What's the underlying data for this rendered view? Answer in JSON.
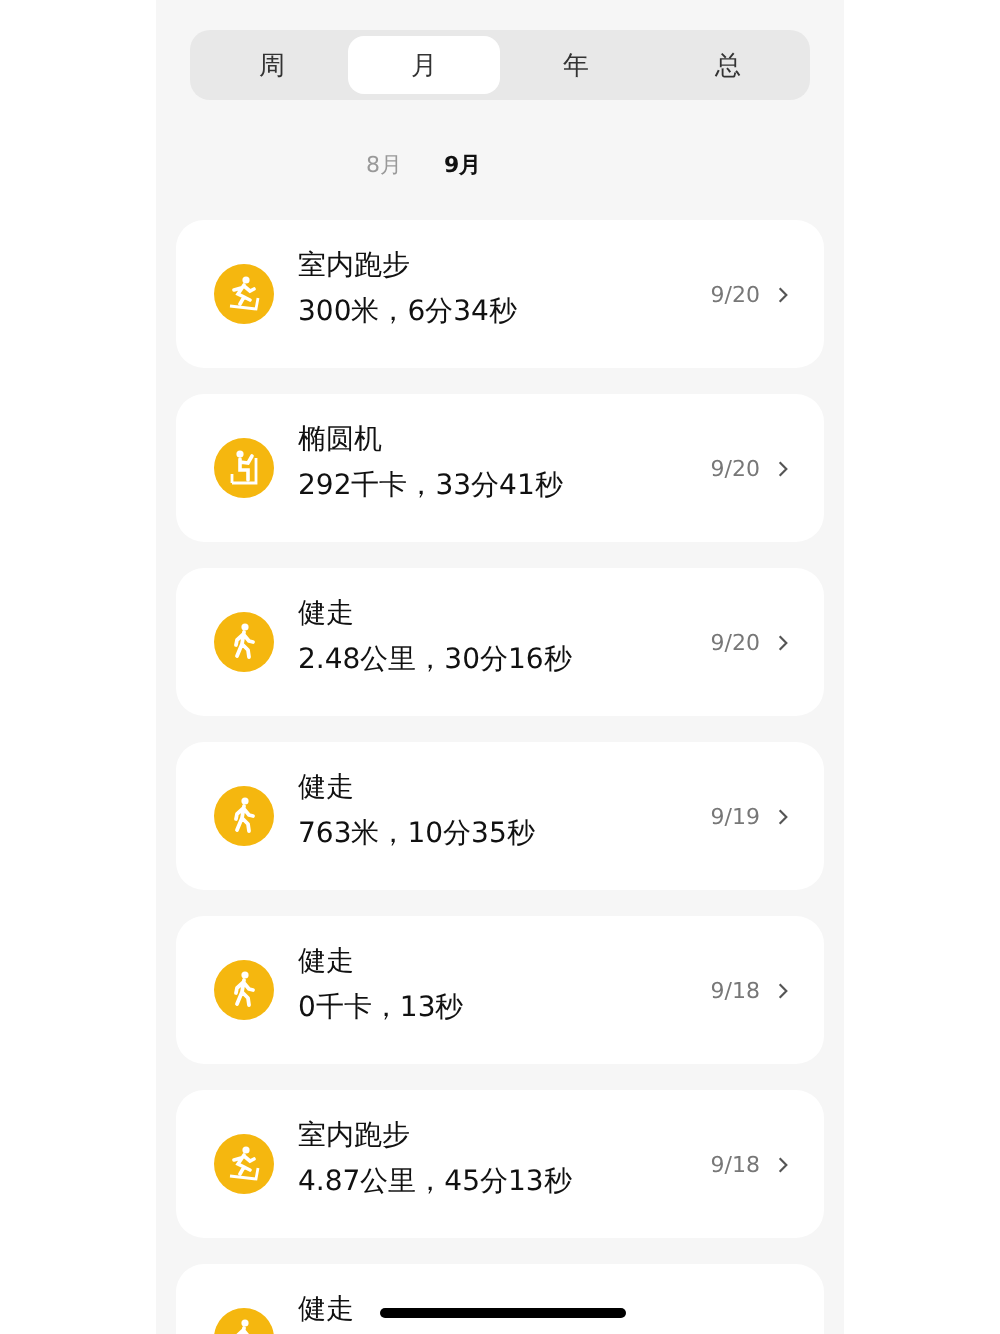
{
  "tabs": [
    {
      "label": "周",
      "selected": false
    },
    {
      "label": "月",
      "selected": true
    },
    {
      "label": "年",
      "selected": false
    },
    {
      "label": "总",
      "selected": false
    }
  ],
  "months": [
    {
      "label": "8月",
      "selected": false
    },
    {
      "label": "9月",
      "selected": true
    }
  ],
  "records": [
    {
      "kind": "treadmill",
      "title": "室内跑步",
      "summary": "300米，6分34秒",
      "date": "9/20"
    },
    {
      "kind": "elliptical",
      "title": "椭圆机",
      "summary": "292千卡，33分41秒",
      "date": "9/20"
    },
    {
      "kind": "walk",
      "title": "健走",
      "summary": "2.48公里，30分16秒",
      "date": "9/20"
    },
    {
      "kind": "walk",
      "title": "健走",
      "summary": "763米，10分35秒",
      "date": "9/19"
    },
    {
      "kind": "walk",
      "title": "健走",
      "summary": "0千卡，13秒",
      "date": "9/18"
    },
    {
      "kind": "treadmill",
      "title": "室内跑步",
      "summary": "4.87公里，45分13秒",
      "date": "9/18"
    },
    {
      "kind": "walk",
      "title": "健走"
    }
  ]
}
